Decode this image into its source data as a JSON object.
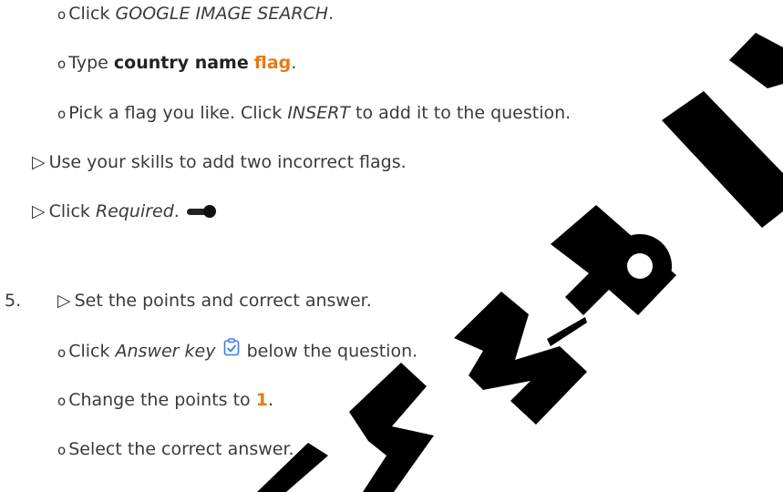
{
  "steps": {
    "step1": {
      "prefix": "Click ",
      "action": "GOOGLE IMAGE SEARCH",
      "suffix": "."
    },
    "step2": {
      "prefix": "Type ",
      "bold": "country name",
      "space": " ",
      "highlight": "flag",
      "suffix": "."
    },
    "step3": {
      "prefix": "Pick a flag you like. Click ",
      "action": "INSERT",
      "suffix": " to add it to the question."
    },
    "step4": {
      "text": "Use your skills to add two incorrect flags."
    },
    "step5": {
      "prefix": "Click ",
      "action": "Required",
      "suffix": "."
    },
    "number": "5.",
    "step6": {
      "text": "Set the points and correct answer."
    },
    "step7": {
      "prefix": "Click ",
      "action": "Answer key",
      "suffix": " below the question."
    },
    "step8": {
      "prefix": "Change the points to ",
      "highlight": "1",
      "suffix": "."
    },
    "step9": {
      "text": "Select the correct answer."
    }
  },
  "glyphs": {
    "bullet": "o",
    "triangle": "▷"
  },
  "colors": {
    "accent": "#e47a1c",
    "icon_blue": "#3b7ddd",
    "watermark": "#000000"
  },
  "icons": {
    "toggle": "toggle-on-icon",
    "answer_key": "answer-key-icon"
  },
  "watermark_text": "SAMPLE"
}
